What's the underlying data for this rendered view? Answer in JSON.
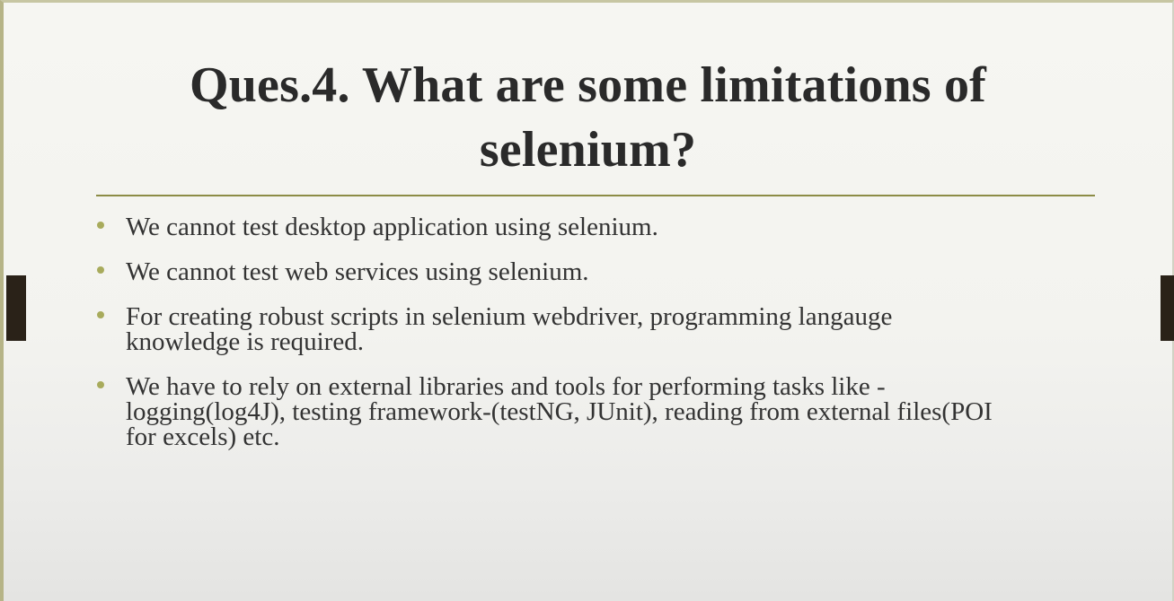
{
  "slide": {
    "title_line1": "Ques.4. What are some limitations of",
    "title_line2": "selenium?",
    "bullets": [
      {
        "lines": [
          "We cannot test desktop application using selenium."
        ]
      },
      {
        "lines": [
          "We cannot test web services using selenium."
        ]
      },
      {
        "lines": [
          "For creating robust scripts in selenium webdriver, programming langauge",
          "knowledge is required."
        ]
      },
      {
        "lines": [
          "We have to rely on external libraries and tools for performing tasks like -",
          "logging(log4J), testing framework-(testNG, JUnit), reading from external files(POI",
          "for excels) etc."
        ]
      }
    ]
  },
  "colors": {
    "title": "#2a2a2a",
    "divider": "#8c8c46",
    "bullet": "#a8ab5c",
    "text": "#333333"
  }
}
